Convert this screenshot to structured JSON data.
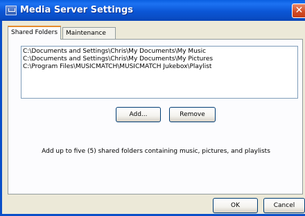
{
  "window": {
    "title": "Media Server Settings",
    "close_symbol": "✕"
  },
  "tabs": [
    {
      "label": "Shared Folders",
      "active": true
    },
    {
      "label": "Maintenance",
      "active": false
    }
  ],
  "shared_folders": {
    "items": [
      "C:\\Documents and Settings\\Chris\\My Documents\\My Music",
      "C:\\Documents and Settings\\Chris\\My Documents\\My Pictures",
      "C:\\Program Files\\MUSICMATCH\\MUSICMATCH Jukebox\\Playlist"
    ],
    "add_label": "Add...",
    "remove_label": "Remove",
    "help_text": "Add up to five (5) shared folders containing music, pictures, and playlists"
  },
  "footer": {
    "ok_label": "OK",
    "cancel_label": "Cancel"
  },
  "colors": {
    "titlebar": "#0a5fe0",
    "window_bg": "#ece9d8",
    "close_button": "#d14a24",
    "active_tab_accent": "#e68b2c"
  }
}
